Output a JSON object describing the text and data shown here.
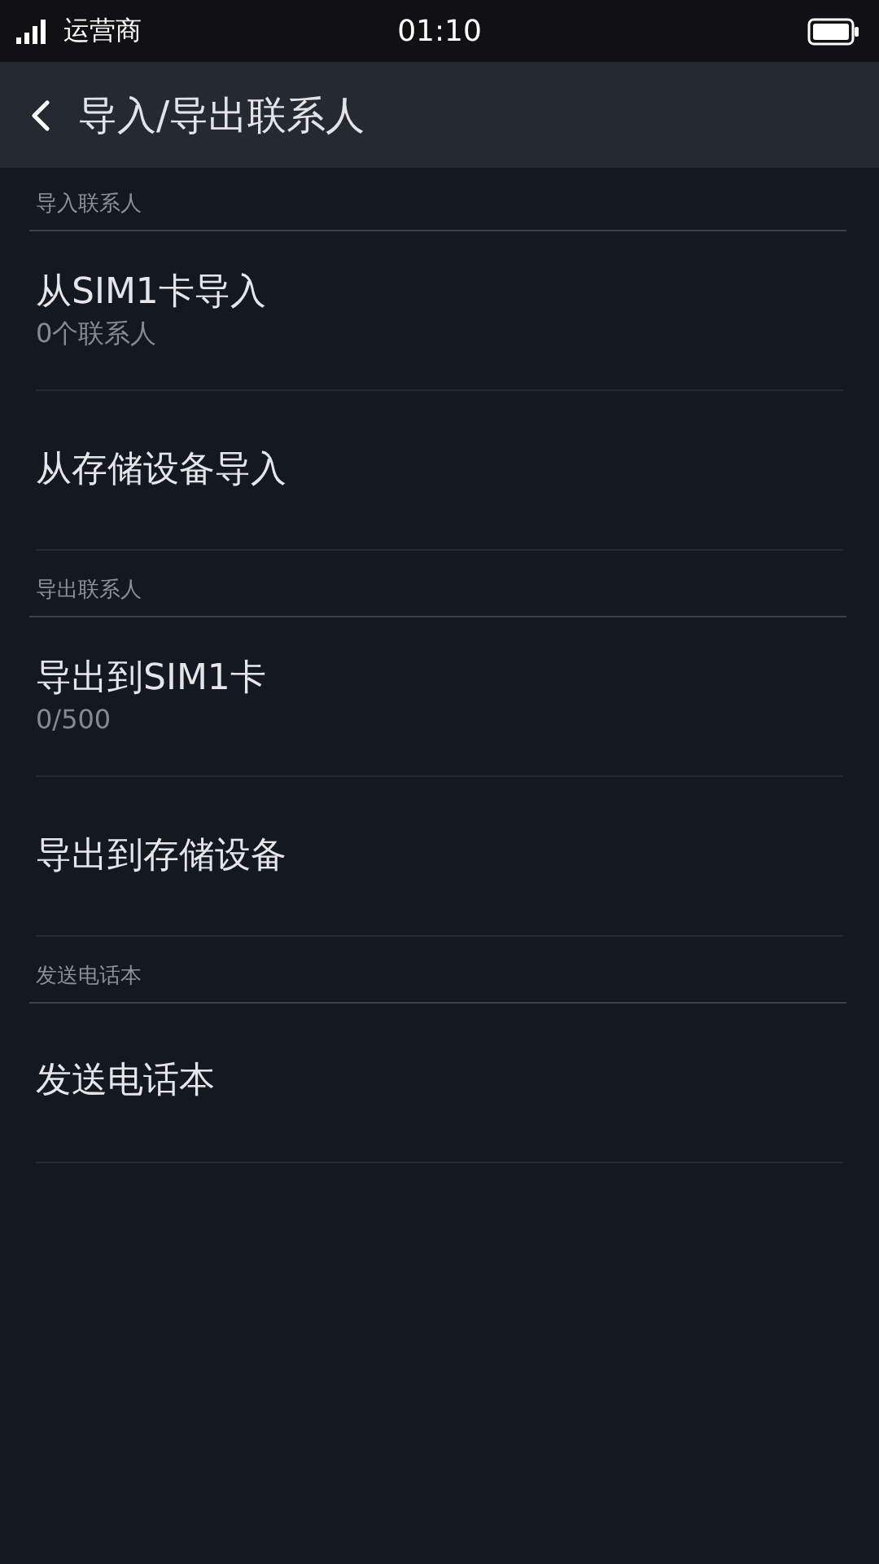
{
  "status_bar": {
    "carrier": "运营商",
    "time": "01:10"
  },
  "header": {
    "title": "导入/导出联系人"
  },
  "sections": [
    {
      "title": "导入联系人",
      "items": [
        {
          "title": "从SIM1卡导入",
          "subtitle": "0个联系人"
        },
        {
          "title": "从存储设备导入"
        }
      ]
    },
    {
      "title": "导出联系人",
      "items": [
        {
          "title": "导出到SIM1卡",
          "subtitle": "0/500"
        },
        {
          "title": "导出到存储设备"
        }
      ]
    },
    {
      "title": "发送电话本",
      "items": [
        {
          "title": "发送电话本"
        }
      ]
    }
  ]
}
